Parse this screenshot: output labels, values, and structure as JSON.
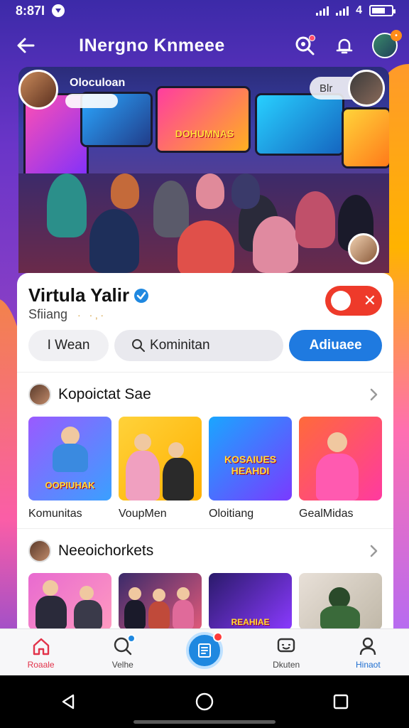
{
  "status_bar": {
    "time": "8:87Ɩ",
    "network": "4"
  },
  "header": {
    "title": "INergno Knmeee"
  },
  "hero": {
    "owner_name": "Oloculoan",
    "chip_right": "Blr",
    "poster_text": "DOHUMNAS"
  },
  "profile": {
    "name": "Virtula Yalir",
    "subname": "Sfiiang",
    "sparkles": "· ·‚·"
  },
  "actions": {
    "mean_label": "I Wean",
    "search_label": "Kominitan",
    "action_label": "Adiuaee"
  },
  "section1": {
    "title": "Kopoictat Sae",
    "tiles": [
      {
        "label": "Komunitas",
        "art_text": "OOPIUHAK"
      },
      {
        "label": "VoupMen",
        "art_text": ""
      },
      {
        "label": "Oloitiang",
        "art_text": "KOSAIUES HEAHDI"
      },
      {
        "label": "GealMidas",
        "art_text": ""
      }
    ]
  },
  "section2": {
    "title": "Neeoichorkets",
    "tiles": [
      {
        "label": ""
      },
      {
        "label": ""
      },
      {
        "label": "",
        "art_text": "REAHIAE"
      },
      {
        "label": ""
      }
    ]
  },
  "bottom_nav": {
    "home": "Roaale",
    "explore": "Velhe",
    "messages": "Dkuten",
    "profile": "Hinaot"
  },
  "colors": {
    "accent_blue": "#1f7ae0",
    "toggle_red": "#ee3a2a",
    "active_nav": "#e2334a"
  }
}
